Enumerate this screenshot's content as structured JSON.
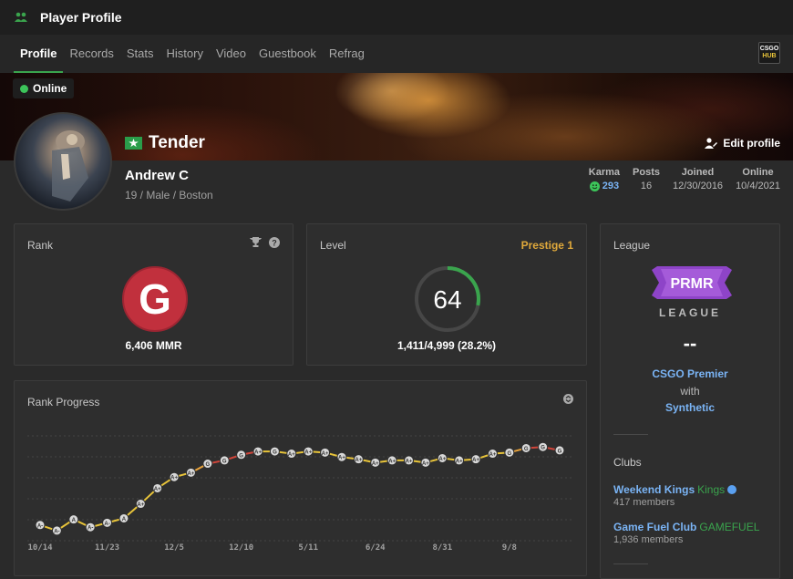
{
  "window": {
    "title": "Player Profile"
  },
  "tabs": [
    "Profile",
    "Records",
    "Stats",
    "History",
    "Video",
    "Guestbook",
    "Refrag"
  ],
  "hub_icon": {
    "line1": "CSGO",
    "line2": "HUB"
  },
  "status": {
    "label": "Online"
  },
  "profile": {
    "nickname": "Tender",
    "real_name": "Andrew C",
    "details": "19 / Male / Boston",
    "edit_label": "Edit profile"
  },
  "stats": {
    "karma": {
      "label": "Karma",
      "value": "293"
    },
    "posts": {
      "label": "Posts",
      "value": "16"
    },
    "joined": {
      "label": "Joined",
      "value": "12/30/2016"
    },
    "online": {
      "label": "Online",
      "value": "10/4/2021"
    }
  },
  "rank": {
    "title": "Rank",
    "badge": "G",
    "mmr": "6,406 MMR",
    "badge_color": "#c1303d"
  },
  "level": {
    "title": "Level",
    "prestige": "Prestige 1",
    "value": "64",
    "xp": "1,411/4,999 (28.2%)",
    "progress": 0.282
  },
  "league": {
    "title": "League",
    "badge": "PRMR",
    "badge_sub": "LEAGUE",
    "value": "--",
    "line1": "CSGO Premier",
    "line2": "with",
    "line3": "Synthetic"
  },
  "clubs": {
    "title": "Clubs",
    "items": [
      {
        "name": "Weekend Kings",
        "tag": "Kings",
        "members": "417 members",
        "verified": true
      },
      {
        "name": "Game Fuel Club",
        "tag": "GAMEFUEL",
        "members": "1,936 members",
        "verified": false
      }
    ]
  },
  "rank_progress": {
    "title": "Rank Progress"
  },
  "chart_data": {
    "type": "line",
    "title": "Rank Progress",
    "x_tick_labels": [
      "10/14",
      "11/23",
      "12/5",
      "12/10",
      "5/11",
      "6/24",
      "8/31",
      "9/8"
    ],
    "ranks": [
      "A-",
      "A-",
      "A",
      "A-",
      "A-",
      "A",
      "A+",
      "A+",
      "A+",
      "A+",
      "G",
      "G",
      "G",
      "A+",
      "G",
      "A+",
      "A+",
      "A+",
      "A+",
      "A+",
      "A+",
      "A+",
      "A+",
      "A+",
      "A+",
      "A+",
      "A+",
      "A+",
      "G",
      "G",
      "G",
      "G"
    ],
    "rank_scale": [
      "A-",
      "A",
      "A+",
      "G"
    ],
    "values": [
      1.0,
      0.5,
      1.5,
      0.8,
      1.2,
      1.6,
      2.9,
      4.3,
      5.3,
      5.7,
      6.5,
      6.8,
      7.3,
      7.6,
      7.6,
      7.4,
      7.6,
      7.5,
      7.1,
      6.9,
      6.6,
      6.8,
      6.8,
      6.6,
      7.0,
      6.8,
      6.9,
      7.4,
      7.5,
      7.9,
      8.0,
      7.7
    ],
    "segment_colors": [
      "#e8c43a",
      "#e8c43a",
      "#e8c43a",
      "#e8c43a",
      "#e8c43a",
      "#e8c43a",
      "#e8c43a",
      "#e8c43a",
      "#e8c43a",
      "#e8a23a",
      "#d0453a",
      "#d0453a",
      "#d0453a",
      "#e8c43a",
      "#e8c43a",
      "#e8c43a",
      "#e8c43a",
      "#e8c43a",
      "#e8c43a",
      "#e8c43a",
      "#e8c43a",
      "#e8c43a",
      "#e8c43a",
      "#e8c43a",
      "#e8c43a",
      "#e8c43a",
      "#e8c43a",
      "#e8c43a",
      "#e8a23a",
      "#d0453a",
      "#d0453a"
    ],
    "grid": true
  },
  "colors": {
    "accent": "#3aa44d",
    "link": "#7ab4f5",
    "prestige": "#e0a93b",
    "league_purple": "#8e44c8"
  }
}
